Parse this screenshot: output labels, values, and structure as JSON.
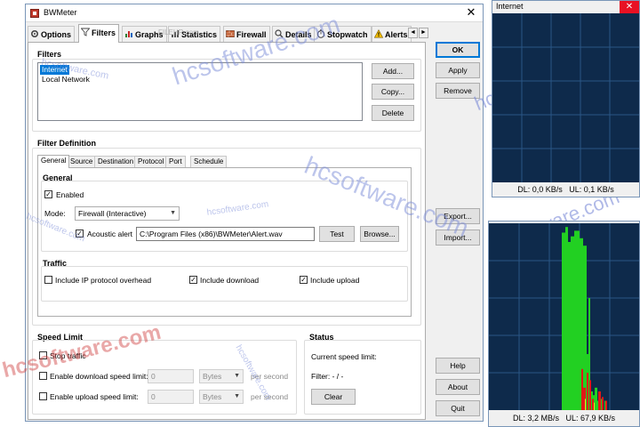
{
  "window": {
    "title": "BWMeter",
    "close_glyph": "✕",
    "tabs": [
      {
        "label": "Options"
      },
      {
        "label": "Filters"
      },
      {
        "label": "Graphs"
      },
      {
        "label": "Statistics"
      },
      {
        "label": "Firewall"
      },
      {
        "label": "Details"
      },
      {
        "label": "Stopwatch"
      },
      {
        "label": "Alerts"
      }
    ],
    "tab_scroll_left": "◄",
    "tab_scroll_right": "►"
  },
  "dialog_buttons": {
    "ok": "OK",
    "apply": "Apply",
    "remove": "Remove",
    "export": "Export...",
    "import": "Import...",
    "help": "Help",
    "about": "About",
    "quit": "Quit"
  },
  "filters": {
    "title": "Filters",
    "items": [
      "Internet",
      "Local Network"
    ],
    "selected_index": 0,
    "add": "Add...",
    "copy": "Copy...",
    "delete": "Delete"
  },
  "filter_definition": {
    "title": "Filter Definition",
    "tabs": [
      "General",
      "Source",
      "Destination",
      "Protocol",
      "Port",
      "Schedule"
    ],
    "general": {
      "title": "General",
      "enabled_label": "Enabled",
      "enabled_checked": true,
      "mode_label": "Mode:",
      "mode_value": "Firewall (Interactive)",
      "acoustic_label": "Acoustic alert",
      "acoustic_checked": true,
      "acoustic_path": "C:\\Program Files (x86)\\BWMeter\\Alert.wav",
      "test": "Test",
      "browse": "Browse..."
    },
    "traffic": {
      "title": "Traffic",
      "ip_overhead_label": "Include IP protocol overhead",
      "ip_overhead_checked": false,
      "download_label": "Include download",
      "download_checked": true,
      "upload_label": "Include upload",
      "upload_checked": true
    }
  },
  "speed_limit": {
    "title": "Speed Limit",
    "stop_traffic": "Stop traffic",
    "download_label": "Enable download speed limit:",
    "upload_label": "Enable upload speed limit:",
    "download_value": "0",
    "upload_value": "0",
    "unit": "Bytes",
    "per": "per second"
  },
  "status": {
    "title": "Status",
    "current_speed_label": "Current speed limit:",
    "filter_label": "Filter: - / -",
    "clear": "Clear"
  },
  "watermarks": {
    "main": "hcsoftware.com",
    "small": "FILEHR",
    "small_sub": ".com"
  },
  "graphs": [
    {
      "title": "Internet",
      "close": "✕",
      "dl": "DL: 0,0 KB/s",
      "ul": "UL: 0,1 KB/s"
    },
    {
      "title": "",
      "dl": "DL: 3,2 MB/s",
      "ul": "UL: 67,9 KB/s",
      "download_color": "#22d022",
      "upload_color": "#e01818"
    }
  ],
  "colors": {
    "graph_background": "#0e2a4b",
    "graph_grid": "#2a5686",
    "selection": "#0078d7",
    "watermark": "#7c8cd8",
    "watermark_dark": "#d04040"
  }
}
